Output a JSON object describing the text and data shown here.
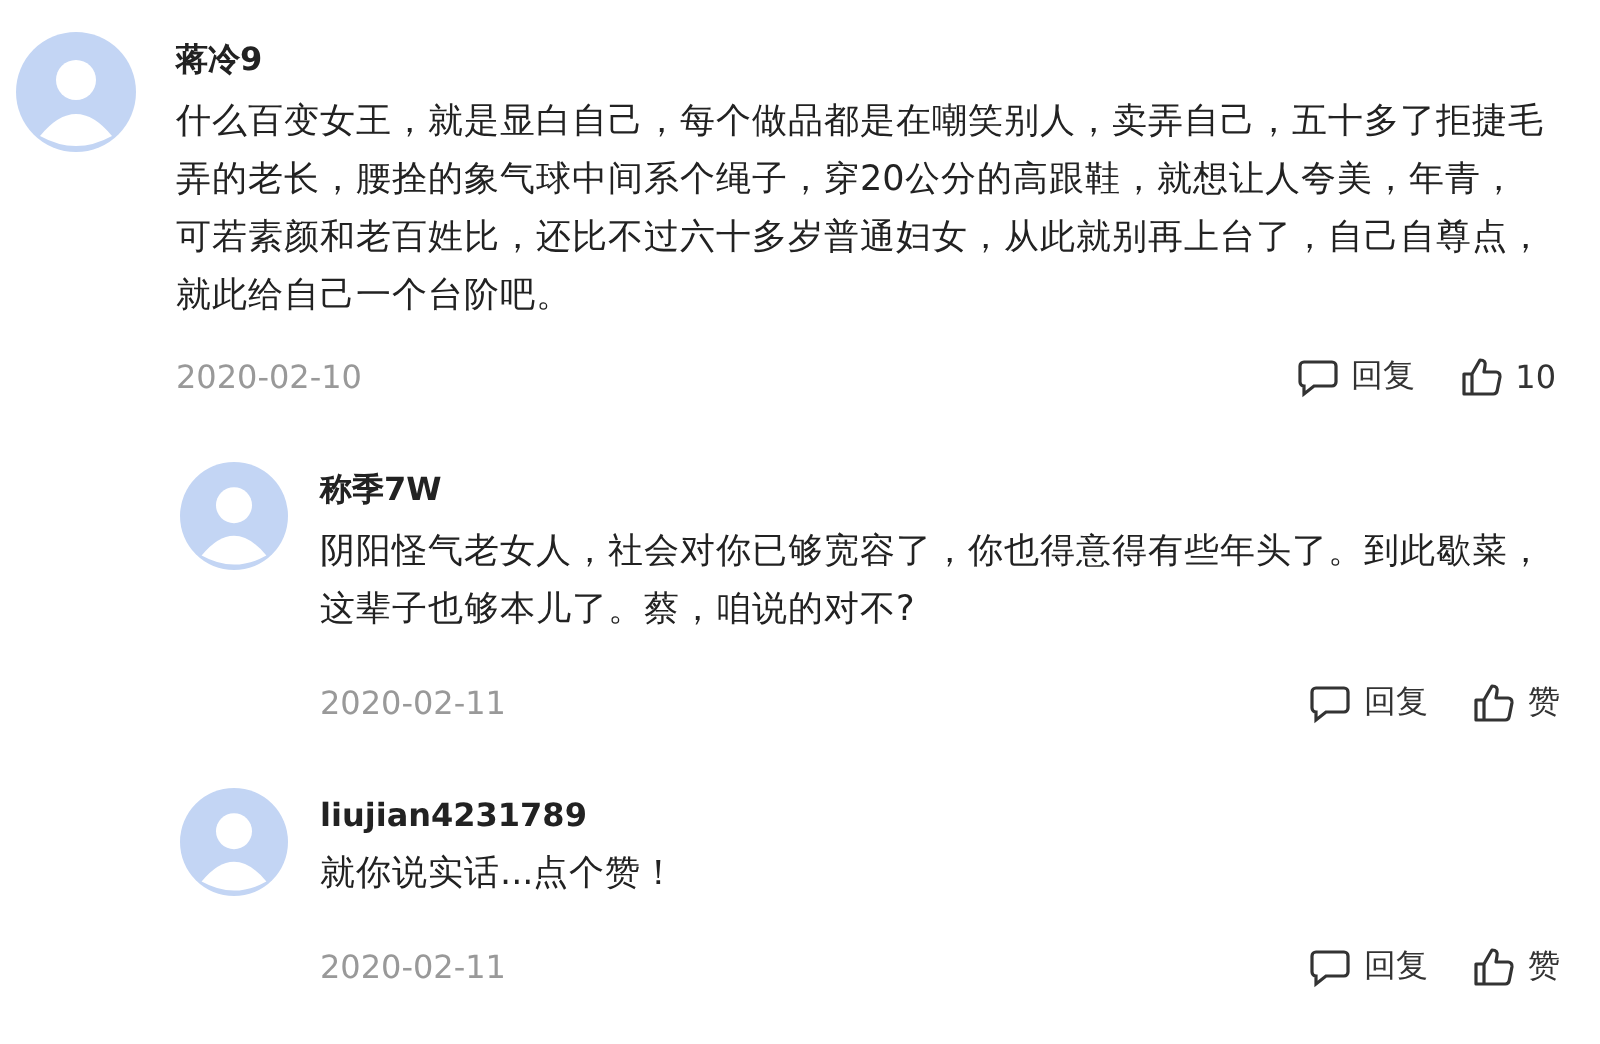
{
  "comments": [
    {
      "name": "蒋冷9",
      "text": "什么百变女王，就是显白自己，每个做品都是在嘲笑别人，卖弄自己，五十多了拒捷毛弄的老长，腰拴的象气球中间系个绳子，穿20公分的高跟鞋，就想让人夸美，年青，可若素颜和老百姓比，还比不过六十多岁普通妇女，从此就别再上台了，自己自尊点，就此给自己一个台阶吧。",
      "date": "2020-02-10",
      "reply": "回复",
      "like": "10",
      "children": [
        {
          "name": "称季7W",
          "text": "阴阳怪气老女人，社会对你已够宽容了，你也得意得有些年头了。到此歇菜，这辈子也够本儿了。蔡，咱说的对不?",
          "date": "2020-02-11",
          "reply": "回复",
          "like": "赞"
        },
        {
          "name": "liujian4231789",
          "text": "就你说实话...点个赞！",
          "date": "2020-02-11",
          "reply": "回复",
          "like": "赞"
        }
      ]
    }
  ]
}
